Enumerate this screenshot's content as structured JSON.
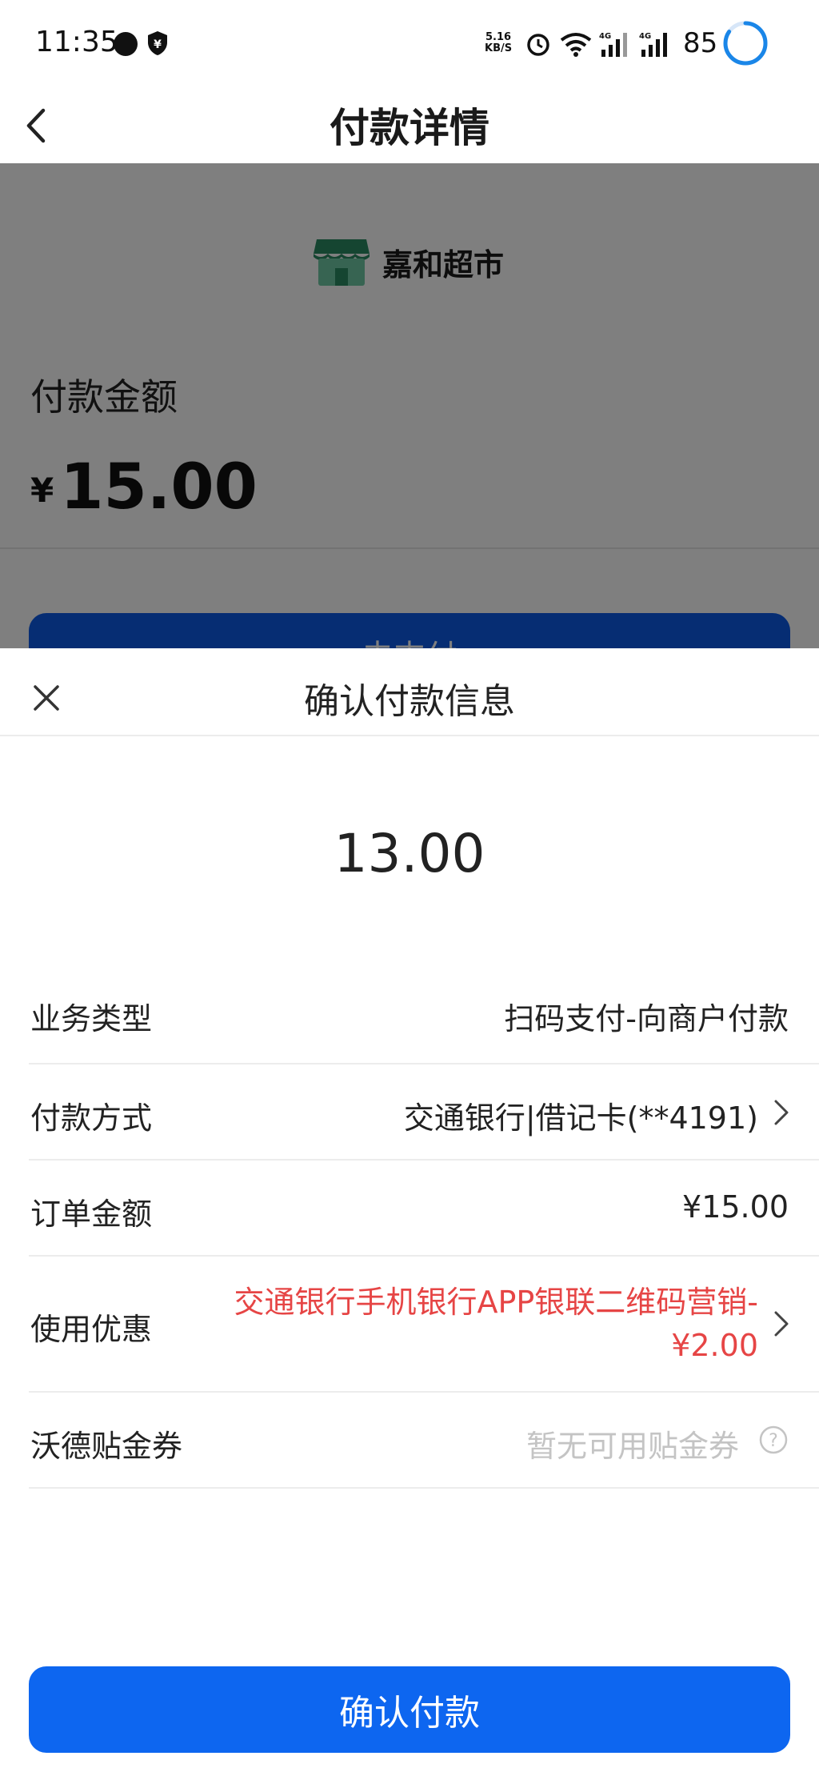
{
  "status_bar": {
    "time": "11:35",
    "net_speed_value": "5.16",
    "net_speed_unit": "KB/S",
    "battery": "85",
    "network_type": "4G"
  },
  "header": {
    "title": "付款详情",
    "back_icon": "chevron-left-icon"
  },
  "background": {
    "merchant_name": "嘉和超市",
    "amount_label": "付款金额",
    "currency": "¥",
    "amount": "15.00",
    "pay_button_label": "去支付"
  },
  "sheet": {
    "title": "确认付款信息",
    "close_icon": "close-icon",
    "pay_amount": "13.00",
    "rows": [
      {
        "label": "业务类型",
        "value": "扫码支付-向商户付款"
      },
      {
        "label": "付款方式",
        "value": "交通银行|借记卡(**4191)"
      },
      {
        "label": "订单金额",
        "value": "¥15.00"
      },
      {
        "label": "使用优惠",
        "value_line1": "交通银行手机银行APP银联二维码营销-",
        "value_line2": "¥2.00"
      },
      {
        "label": "沃德贴金券",
        "value": "暂无可用贴金券"
      }
    ],
    "confirm_label": "确认付款"
  },
  "colors": {
    "primary": "#0d66f0",
    "discount_red": "#e64545",
    "placeholder_gray": "#c4c4c4"
  }
}
